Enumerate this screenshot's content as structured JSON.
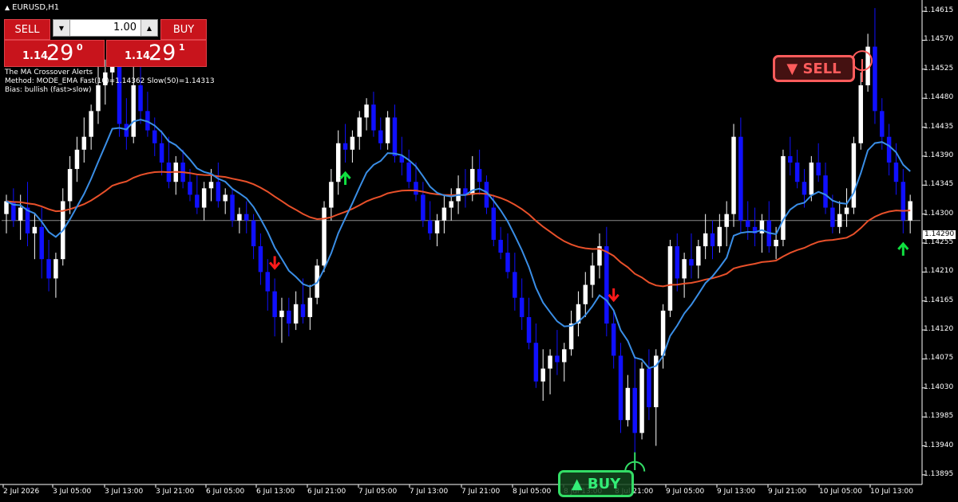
{
  "window": {
    "title": "EURUSD,H1",
    "title_icon": "triangle-up-icon"
  },
  "trade_panel": {
    "sell_label": "SELL",
    "buy_label": "BUY",
    "lot": "1.00",
    "sell_price": {
      "big_prefix": "1.14",
      "big": "29",
      "sup": "0"
    },
    "buy_price": {
      "big_prefix": "1.14",
      "big": "29",
      "sup": "1"
    }
  },
  "indicator": {
    "line1": "The MA Crossover Alerts",
    "line2": "Method: MODE_EMA   Fast(10)=1.14362   Slow(50)=1.14313",
    "line3": "Bias: bullish (fast>slow)"
  },
  "price_axis": [
    "1.14615",
    "1.14570",
    "1.14525",
    "1.14480",
    "1.14435",
    "1.14390",
    "1.14345",
    "1.14300",
    "1.14255",
    "1.14210",
    "1.14165",
    "1.14120",
    "1.14075",
    "1.14030",
    "1.13985",
    "1.13940",
    "1.13895"
  ],
  "current_price": "1.14290",
  "time_axis": [
    "2 Jul 2026",
    "3 Jul 05:00",
    "3 Jul 13:00",
    "3 Jul 21:00",
    "6 Jul 05:00",
    "6 Jul 13:00",
    "6 Jul 21:00",
    "7 Jul 05:00",
    "7 Jul 13:00",
    "7 Jul 21:00",
    "8 Jul 05:00",
    "8 Jul 13:00",
    "8 Jul 21:00",
    "9 Jul 05:00",
    "9 Jul 13:00",
    "9 Jul 21:00",
    "10 Jul 05:00",
    "10 Jul 13:00"
  ],
  "badges": {
    "sell": "▼ SELL",
    "buy": "▲ BUY"
  },
  "colors": {
    "bull": "#ffffff",
    "bear": "#1010ff",
    "fast_ma": "#3a8ee6",
    "slow_ma": "#e8502a",
    "sell_arrow": "#ff1a1a",
    "buy_arrow": "#10e040",
    "trade_red": "#c8141c"
  },
  "chart_data": {
    "type": "candlestick",
    "symbol": "EURUSD",
    "timeframe": "H1",
    "ylim": [
      1.1388,
      1.1463
    ],
    "candles": [
      [
        1.143,
        1.1433,
        1.1427,
        1.1432
      ],
      [
        1.1432,
        1.1434,
        1.1428,
        1.1429
      ],
      [
        1.1429,
        1.1433,
        1.1426,
        1.1431
      ],
      [
        1.1431,
        1.1435,
        1.1425,
        1.1427
      ],
      [
        1.1427,
        1.143,
        1.1423,
        1.1428
      ],
      [
        1.1428,
        1.1431,
        1.142,
        1.1423
      ],
      [
        1.1423,
        1.1426,
        1.1418,
        1.142
      ],
      [
        1.142,
        1.1424,
        1.1417,
        1.1423
      ],
      [
        1.1423,
        1.1434,
        1.1422,
        1.1432
      ],
      [
        1.1432,
        1.1439,
        1.143,
        1.1437
      ],
      [
        1.1437,
        1.1442,
        1.1435,
        1.144
      ],
      [
        1.144,
        1.1445,
        1.1438,
        1.1442
      ],
      [
        1.1442,
        1.1447,
        1.144,
        1.1446
      ],
      [
        1.1446,
        1.1453,
        1.1444,
        1.145
      ],
      [
        1.145,
        1.1454,
        1.1447,
        1.1452
      ],
      [
        1.1452,
        1.1457,
        1.145,
        1.1455
      ],
      [
        1.1455,
        1.1456,
        1.1442,
        1.1444
      ],
      [
        1.1444,
        1.1448,
        1.144,
        1.1442
      ],
      [
        1.1442,
        1.1454,
        1.1441,
        1.145
      ],
      [
        1.145,
        1.1453,
        1.1444,
        1.1446
      ],
      [
        1.1446,
        1.1449,
        1.1442,
        1.1443
      ],
      [
        1.1443,
        1.1445,
        1.1439,
        1.1441
      ],
      [
        1.1441,
        1.1443,
        1.1436,
        1.1438
      ],
      [
        1.1438,
        1.1442,
        1.1434,
        1.1435
      ],
      [
        1.1435,
        1.1439,
        1.1433,
        1.1438
      ],
      [
        1.1438,
        1.144,
        1.1434,
        1.1435
      ],
      [
        1.1435,
        1.1437,
        1.1432,
        1.1433
      ],
      [
        1.1433,
        1.1436,
        1.143,
        1.1431
      ],
      [
        1.1431,
        1.1435,
        1.1429,
        1.1434
      ],
      [
        1.1434,
        1.1437,
        1.1432,
        1.1435
      ],
      [
        1.1435,
        1.1438,
        1.1431,
        1.1432
      ],
      [
        1.1432,
        1.1434,
        1.143,
        1.1433
      ],
      [
        1.1433,
        1.1434,
        1.1428,
        1.1429
      ],
      [
        1.1429,
        1.1431,
        1.1427,
        1.143
      ],
      [
        1.143,
        1.1432,
        1.1427,
        1.1429
      ],
      [
        1.1429,
        1.143,
        1.1423,
        1.1425
      ],
      [
        1.1425,
        1.1427,
        1.1419,
        1.1421
      ],
      [
        1.1421,
        1.1423,
        1.1415,
        1.1418
      ],
      [
        1.1418,
        1.142,
        1.1411,
        1.1414
      ],
      [
        1.1414,
        1.1417,
        1.141,
        1.1415
      ],
      [
        1.1415,
        1.1417,
        1.1411,
        1.1413
      ],
      [
        1.1413,
        1.1418,
        1.1412,
        1.1416
      ],
      [
        1.1416,
        1.142,
        1.1413,
        1.1414
      ],
      [
        1.1414,
        1.1419,
        1.1412,
        1.1417
      ],
      [
        1.1417,
        1.1423,
        1.1416,
        1.1422
      ],
      [
        1.1422,
        1.1432,
        1.1421,
        1.1431
      ],
      [
        1.1431,
        1.1437,
        1.1429,
        1.1435
      ],
      [
        1.1435,
        1.1443,
        1.1433,
        1.1441
      ],
      [
        1.1441,
        1.1444,
        1.1438,
        1.144
      ],
      [
        1.144,
        1.1443,
        1.1438,
        1.1442
      ],
      [
        1.1442,
        1.1446,
        1.144,
        1.1445
      ],
      [
        1.1445,
        1.1448,
        1.1443,
        1.1447
      ],
      [
        1.1447,
        1.1449,
        1.1442,
        1.1443
      ],
      [
        1.1443,
        1.1445,
        1.144,
        1.1441
      ],
      [
        1.1441,
        1.1446,
        1.144,
        1.1445
      ],
      [
        1.1445,
        1.1447,
        1.1438,
        1.1439
      ],
      [
        1.1439,
        1.1442,
        1.1436,
        1.1438
      ],
      [
        1.1438,
        1.144,
        1.1434,
        1.1435
      ],
      [
        1.1435,
        1.1438,
        1.1432,
        1.1433
      ],
      [
        1.1433,
        1.1435,
        1.1428,
        1.1429
      ],
      [
        1.1429,
        1.1432,
        1.1426,
        1.1427
      ],
      [
        1.1427,
        1.143,
        1.1425,
        1.1429
      ],
      [
        1.1429,
        1.1433,
        1.1427,
        1.1431
      ],
      [
        1.1431,
        1.1434,
        1.1429,
        1.1432
      ],
      [
        1.1432,
        1.1436,
        1.143,
        1.1434
      ],
      [
        1.1434,
        1.1437,
        1.1431,
        1.1433
      ],
      [
        1.1433,
        1.1439,
        1.1432,
        1.1437
      ],
      [
        1.1437,
        1.144,
        1.1433,
        1.1435
      ],
      [
        1.1435,
        1.1436,
        1.143,
        1.1431
      ],
      [
        1.1431,
        1.1433,
        1.1425,
        1.1426
      ],
      [
        1.1426,
        1.1428,
        1.1423,
        1.1424
      ],
      [
        1.1424,
        1.1427,
        1.142,
        1.1421
      ],
      [
        1.1421,
        1.1424,
        1.1415,
        1.1417
      ],
      [
        1.1417,
        1.142,
        1.1412,
        1.1414
      ],
      [
        1.1414,
        1.1417,
        1.1409,
        1.141
      ],
      [
        1.141,
        1.1413,
        1.1403,
        1.1404
      ],
      [
        1.1404,
        1.1409,
        1.1401,
        1.1406
      ],
      [
        1.1406,
        1.1409,
        1.1402,
        1.1408
      ],
      [
        1.1408,
        1.1412,
        1.1405,
        1.1407
      ],
      [
        1.1407,
        1.141,
        1.1404,
        1.1409
      ],
      [
        1.1409,
        1.1415,
        1.1408,
        1.1413
      ],
      [
        1.1413,
        1.1418,
        1.1411,
        1.1416
      ],
      [
        1.1416,
        1.1421,
        1.1414,
        1.1419
      ],
      [
        1.1419,
        1.1424,
        1.1417,
        1.1422
      ],
      [
        1.1422,
        1.1427,
        1.142,
        1.1425
      ],
      [
        1.1425,
        1.1428,
        1.1411,
        1.1413
      ],
      [
        1.1413,
        1.1415,
        1.1406,
        1.1408
      ],
      [
        1.1408,
        1.141,
        1.1396,
        1.1398
      ],
      [
        1.1398,
        1.1405,
        1.1397,
        1.1403
      ],
      [
        1.1403,
        1.1408,
        1.1393,
        1.1396
      ],
      [
        1.1396,
        1.1407,
        1.1395,
        1.1406
      ],
      [
        1.1406,
        1.1409,
        1.1398,
        1.14
      ],
      [
        1.14,
        1.1409,
        1.1394,
        1.1408
      ],
      [
        1.1408,
        1.1416,
        1.1406,
        1.1415
      ],
      [
        1.1415,
        1.1426,
        1.1414,
        1.1425
      ],
      [
        1.1425,
        1.1427,
        1.1418,
        1.142
      ],
      [
        1.142,
        1.1424,
        1.1417,
        1.1423
      ],
      [
        1.1423,
        1.1427,
        1.142,
        1.1422
      ],
      [
        1.1422,
        1.1426,
        1.142,
        1.1425
      ],
      [
        1.1425,
        1.143,
        1.1423,
        1.1427
      ],
      [
        1.1427,
        1.1429,
        1.1423,
        1.1425
      ],
      [
        1.1425,
        1.143,
        1.1424,
        1.1428
      ],
      [
        1.1428,
        1.1432,
        1.1425,
        1.143
      ],
      [
        1.143,
        1.1444,
        1.1428,
        1.1442
      ],
      [
        1.1442,
        1.1445,
        1.1427,
        1.1429
      ],
      [
        1.1429,
        1.1432,
        1.1426,
        1.1428
      ],
      [
        1.1428,
        1.1431,
        1.1425,
        1.1427
      ],
      [
        1.1427,
        1.143,
        1.1424,
        1.1429
      ],
      [
        1.1429,
        1.1432,
        1.1424,
        1.1425
      ],
      [
        1.1425,
        1.1428,
        1.1423,
        1.1426
      ],
      [
        1.1426,
        1.144,
        1.1425,
        1.1439
      ],
      [
        1.1439,
        1.1442,
        1.1436,
        1.1438
      ],
      [
        1.1438,
        1.144,
        1.1434,
        1.1435
      ],
      [
        1.1435,
        1.1437,
        1.1431,
        1.1433
      ],
      [
        1.1433,
        1.1439,
        1.1432,
        1.1438
      ],
      [
        1.1438,
        1.1441,
        1.1435,
        1.1436
      ],
      [
        1.1436,
        1.1438,
        1.143,
        1.1431
      ],
      [
        1.1431,
        1.1433,
        1.1427,
        1.1428
      ],
      [
        1.1428,
        1.1432,
        1.1427,
        1.143
      ],
      [
        1.143,
        1.1434,
        1.1428,
        1.1431
      ],
      [
        1.1431,
        1.1442,
        1.143,
        1.1441
      ],
      [
        1.1441,
        1.1452,
        1.144,
        1.145
      ],
      [
        1.145,
        1.1458,
        1.1449,
        1.1456
      ],
      [
        1.1456,
        1.1462,
        1.1444,
        1.1446
      ],
      [
        1.1446,
        1.1448,
        1.144,
        1.1442
      ],
      [
        1.1442,
        1.1444,
        1.1436,
        1.1438
      ],
      [
        1.1438,
        1.1441,
        1.1433,
        1.1435
      ],
      [
        1.1435,
        1.1437,
        1.1427,
        1.1429
      ],
      [
        1.1429,
        1.1433,
        1.1427,
        1.1432
      ]
    ],
    "fast_ma": {
      "label": "Fast(10)",
      "value": 1.14362
    },
    "slow_ma": {
      "label": "Slow(50)",
      "value": 1.14313
    },
    "signals": [
      {
        "type": "sell-arrow",
        "index": 38
      },
      {
        "type": "buy-arrow",
        "index": 48
      },
      {
        "type": "sell-arrow",
        "index": 86
      },
      {
        "type": "buy-arrow",
        "index": 127
      }
    ]
  }
}
